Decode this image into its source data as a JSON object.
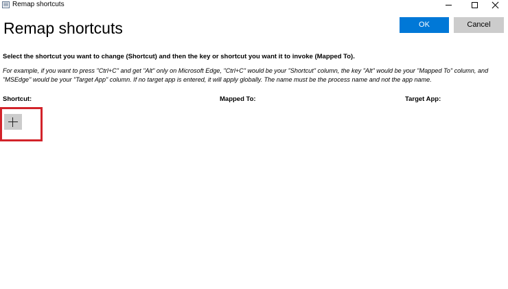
{
  "window": {
    "title": "Remap shortcuts",
    "icons": {
      "app": "keyboard-app-icon",
      "minimize": "minimize-icon",
      "maximize": "maximize-icon",
      "close": "close-icon"
    }
  },
  "header": {
    "title": "Remap shortcuts",
    "ok_label": "OK",
    "cancel_label": "Cancel"
  },
  "instructions": {
    "main": "Select the shortcut you want to change (Shortcut) and then the key or shortcut you want it to invoke (Mapped To).",
    "example": "For example, if you want to press \"Ctrl+C\" and get \"Alt\" only on Microsoft Edge, \"Ctrl+C\" would be your \"Shortcut\" column, the key \"Alt\" would be your \"Mapped To\" column, and \"MSEdge\" would be your \"Target App\" column. If no target app is entered, it will apply globally. The name must be the process name and not the app name."
  },
  "columns": {
    "shortcut": "Shortcut:",
    "mapped_to": "Mapped To:",
    "target_app": "Target App:"
  },
  "add_button": {
    "icon": "plus-icon"
  },
  "colors": {
    "accent": "#0078d7",
    "button_gray": "#cccccc",
    "highlight": "#d2232a"
  }
}
